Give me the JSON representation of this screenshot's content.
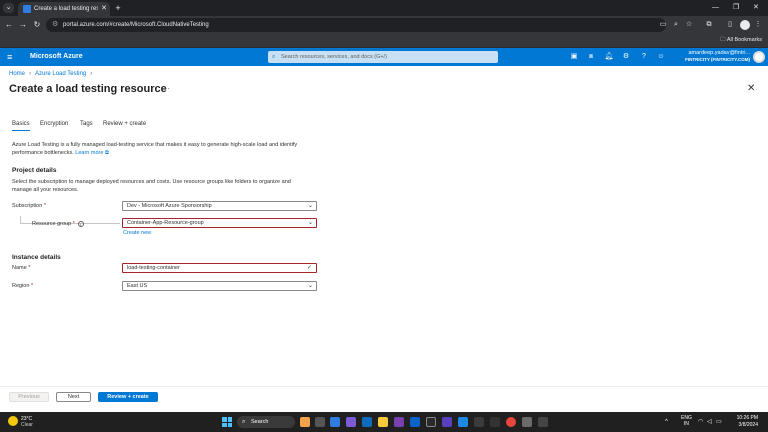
{
  "browser": {
    "tab_title": "Create a load testing resource",
    "url": "portal.azure.com/#create/Microsoft.CloudNativeTesting",
    "bookmarks_label": "All Bookmarks"
  },
  "portal": {
    "brand": "Microsoft Azure",
    "search_placeholder": "Search resources, services, and docs (G+/)",
    "account_name": "amardeep.yadav@fintri...",
    "account_org": "FINTRICITY (FINTRICITY.COM)"
  },
  "breadcrumb": [
    "Home",
    "Azure Load Testing"
  ],
  "page": {
    "title": "Create a load testing resource",
    "more": "···"
  },
  "tabs": [
    {
      "label": "Basics",
      "active": true
    },
    {
      "label": "Encryption",
      "active": false
    },
    {
      "label": "Tags",
      "active": false
    },
    {
      "label": "Review + create",
      "active": false
    }
  ],
  "intro": {
    "text": "Azure Load Testing is a fully managed load-testing service that makes it easy to generate high-scale load and identify performance bottlenecks.",
    "link": "Learn more"
  },
  "project": {
    "heading": "Project details",
    "description": "Select the subscription to manage deployed resources and costs. Use resource groups like folders to organize and manage all your resources.",
    "subscription_label": "Subscription",
    "subscription_value": "Dev - Microsoft Azure Sponsorship",
    "rg_label": "Resource group",
    "rg_value": "Container-App-Resource-group",
    "create_new": "Create new"
  },
  "instance": {
    "heading": "Instance details",
    "name_label": "Name",
    "name_value": "load-testing-container",
    "region_label": "Region",
    "region_value": "East US"
  },
  "footer": {
    "previous": "Previous",
    "next": "Next",
    "review": "Review + create"
  },
  "taskbar": {
    "temp": "23°C",
    "condition": "Clear",
    "search": "Search",
    "lang1": "ENG",
    "lang2": "IN",
    "time": "10:26 PM",
    "date": "3/8/2024"
  },
  "colors": {
    "azure_blue": "#0078d4",
    "required_red": "#a4262c"
  }
}
